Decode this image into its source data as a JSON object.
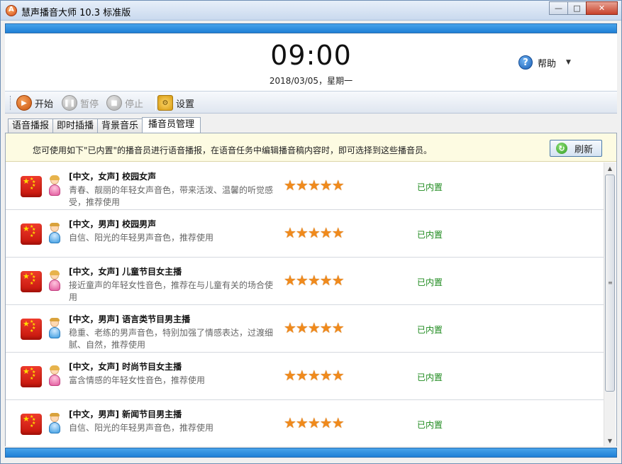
{
  "window": {
    "title": "慧声播音大师 10.3 标准版"
  },
  "win_controls": {
    "minimize": "—",
    "maximize": "□",
    "close": "✕"
  },
  "header": {
    "time": "09:00",
    "date": "2018/03/05，星期一",
    "help_label": "帮助"
  },
  "toolbar": {
    "start_label": "开始",
    "pause_label": "暂停",
    "stop_label": "停止",
    "settings_label": "设置"
  },
  "tabs": [
    "语音播报",
    "即时插播",
    "背景音乐",
    "播音员管理"
  ],
  "active_tab": "播音员管理",
  "notice": {
    "text": "您可使用如下\"已内置\"的播音员进行语音播报，在语音任务中编辑播音稿内容时，即可选择到这些播音员。",
    "refresh_label": "刷新"
  },
  "voices": [
    {
      "name": "[中文，女声] 校园女声",
      "desc": "青春、靓丽的年轻女声音色，带来活泼、温馨的听觉感受，推荐使用",
      "gender": "female",
      "rating": 5,
      "status": "已内置"
    },
    {
      "name": "[中文，男声] 校园男声",
      "desc": "自信、阳光的年轻男声音色，推荐使用",
      "gender": "male",
      "rating": 5,
      "status": "已内置"
    },
    {
      "name": "[中文，女声] 儿童节目女主播",
      "desc": "接近童声的年轻女性音色，推荐在与儿童有关的场合使用",
      "gender": "female",
      "rating": 5,
      "status": "已内置"
    },
    {
      "name": "[中文，男声] 语言类节目男主播",
      "desc": "稳重、老练的男声音色，特别加强了情感表达，过渡细腻、自然，推荐使用",
      "gender": "male",
      "rating": 5,
      "status": "已内置"
    },
    {
      "name": "[中文，女声] 时尚节目女主播",
      "desc": "富含情感的年轻女性音色，推荐使用",
      "gender": "female",
      "rating": 5,
      "status": "已内置"
    },
    {
      "name": "[中文，男声] 新闻节目男主播",
      "desc": "自信、阳光的年轻男声音色，推荐使用",
      "gender": "male",
      "rating": 5,
      "status": "已内置"
    }
  ],
  "colors": {
    "accent_blue": "#1f7fd6",
    "status_green": "#1d8a1d",
    "star_orange": "#f08a1c"
  },
  "icons": {
    "app": "app-logo-icon",
    "help": "help-question-icon",
    "start": "play-icon",
    "pause": "pause-icon",
    "stop": "stop-icon",
    "settings": "gear-icon",
    "refresh": "refresh-icon"
  }
}
